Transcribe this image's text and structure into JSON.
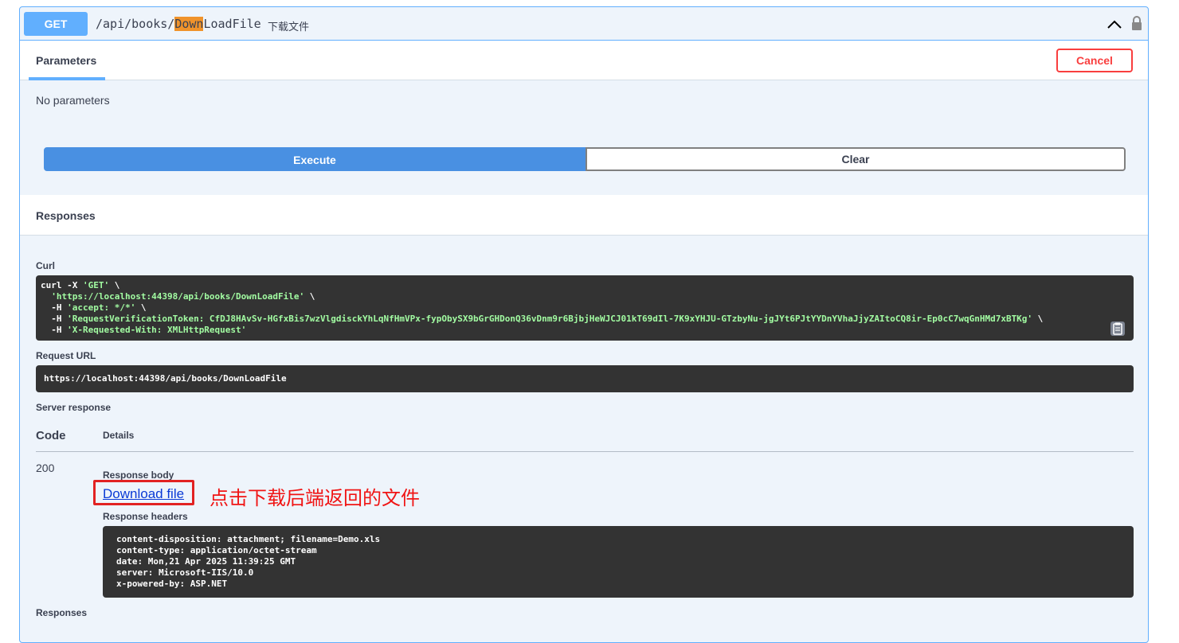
{
  "operation": {
    "method": "GET",
    "path_prefix": "/api/books/",
    "path_highlight": "Down",
    "path_suffix": "LoadFile",
    "description": "下载文件"
  },
  "parameters": {
    "tab_label": "Parameters",
    "cancel_label": "Cancel",
    "empty_text": "No parameters"
  },
  "actions": {
    "execute_label": "Execute",
    "clear_label": "Clear"
  },
  "responses": {
    "section_title": "Responses",
    "curl_label": "Curl",
    "curl_lines": [
      {
        "prefix": "curl -X ",
        "str": "'GET'",
        "suffix": " \\"
      },
      {
        "prefix": "  ",
        "str": "'https://localhost:44398/api/books/DownLoadFile'",
        "suffix": " \\"
      },
      {
        "prefix": "  -H ",
        "str": "'accept: */*'",
        "suffix": " \\"
      },
      {
        "prefix": "  -H ",
        "str": "'RequestVerificationToken: CfDJ8HAvSv-HGfxBis7wzVlgdisckYhLqNfHmVPx-fypObySX9bGrGHDonQ36vDnm9r6BjbjHeWJCJ01kT69dIl-7K9xYHJU-GTzbyNu-jgJYt6PJtYYDnYVhaJjyZAItoCQ8ir-Ep0cC7wqGnHMd7xBTKg'",
        "suffix": " \\"
      },
      {
        "prefix": "  -H ",
        "str": "'X-Requested-With: XMLHttpRequest'",
        "suffix": ""
      }
    ],
    "request_url_label": "Request URL",
    "request_url": "https://localhost:44398/api/books/DownLoadFile",
    "server_response_label": "Server response",
    "code_header": "Code",
    "details_header": "Details",
    "code": "200",
    "response_body_label": "Response body",
    "download_link": "Download file",
    "annotation": "点击下载后端返回的文件",
    "response_headers_label": "Response headers",
    "response_headers": [
      "content-disposition: attachment; filename=Demo.xls",
      "content-type: application/octet-stream",
      "date: Mon,21 Apr 2025 11:39:25 GMT",
      "server: Microsoft-IIS/10.0",
      "x-powered-by: ASP.NET"
    ],
    "bottom_label": "Responses"
  },
  "colors": {
    "get_blue": "#61affe",
    "execute_blue": "#4990e2",
    "cancel_red": "#f93e3e",
    "annotation_red": "#f01414",
    "code_bg": "#333333",
    "string_green": "#a2fca2"
  },
  "icons": {
    "collapse": "chevron-up-icon",
    "auth": "lock-icon",
    "copy": "clipboard-icon"
  }
}
